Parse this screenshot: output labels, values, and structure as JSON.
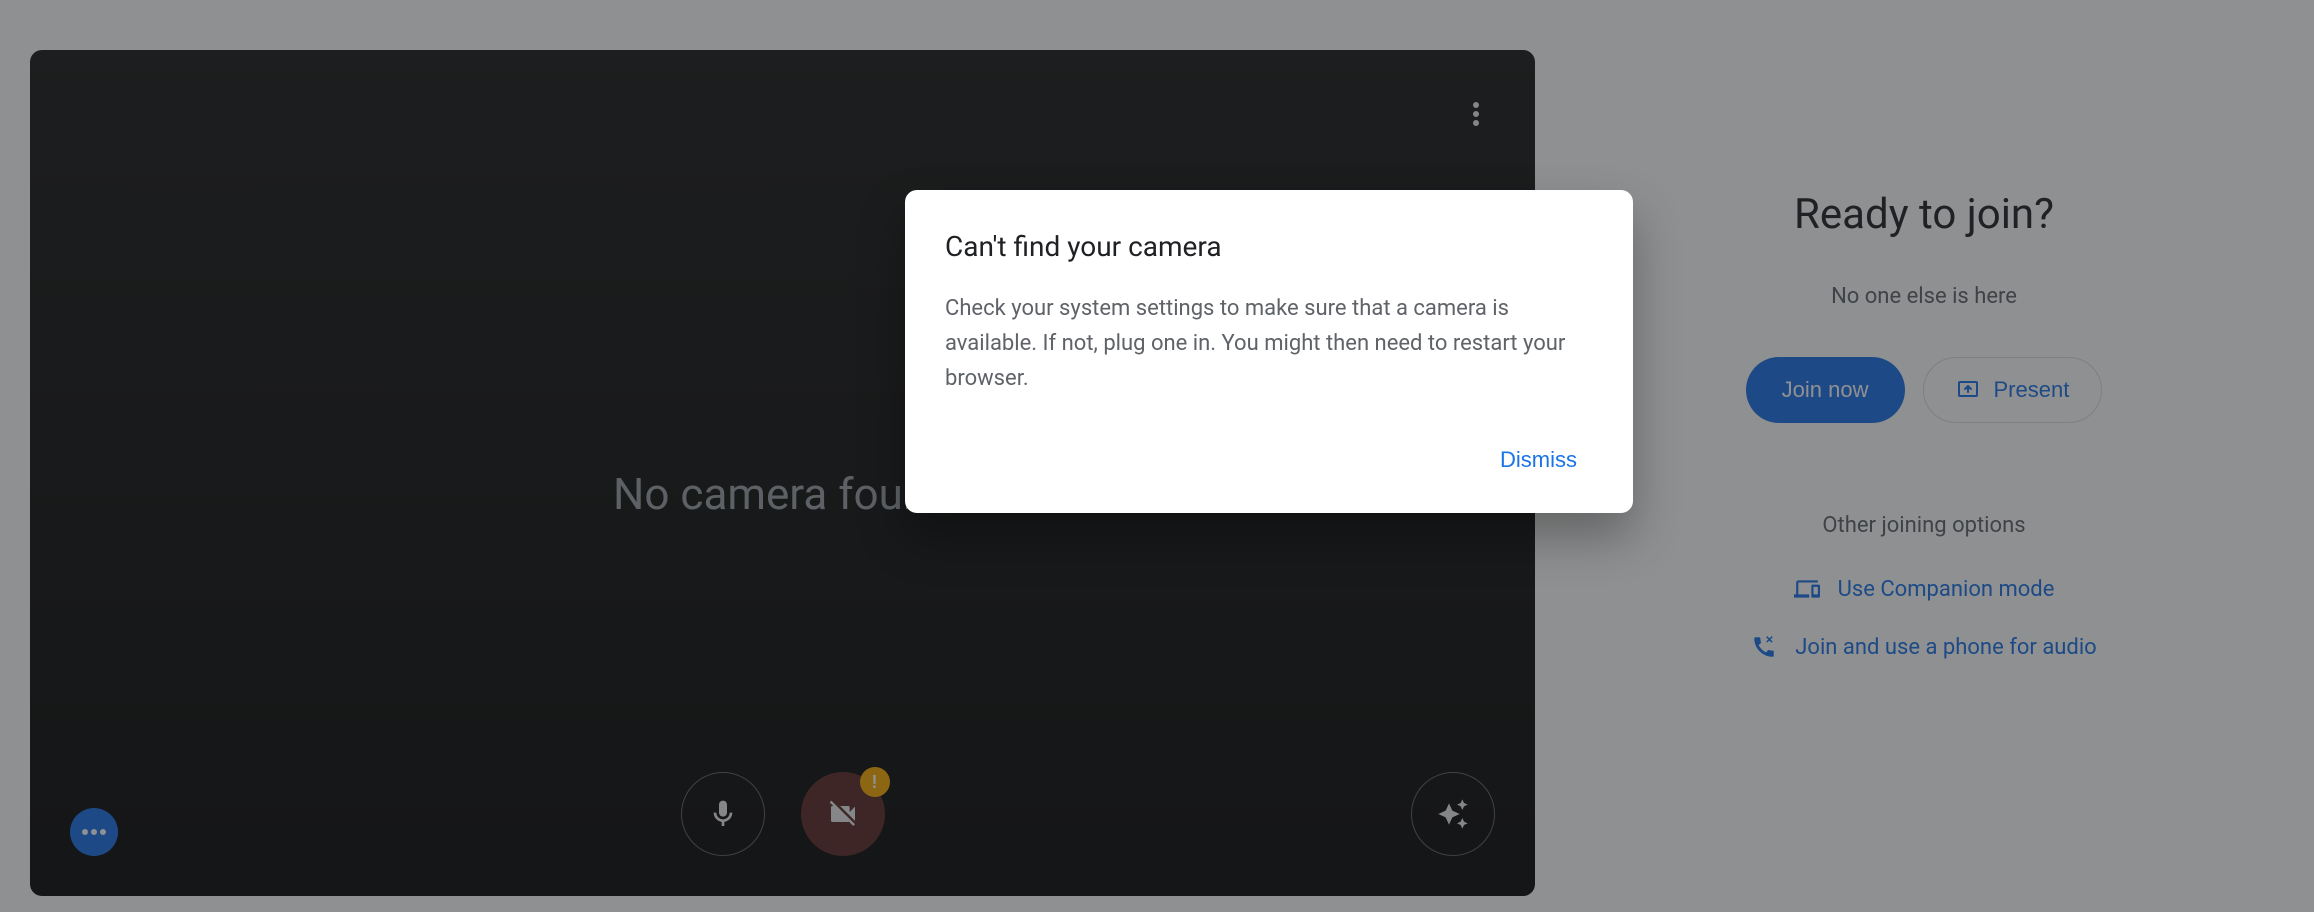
{
  "preview": {
    "no_camera_text": "No camera found"
  },
  "dialog": {
    "title": "Can't find your camera",
    "body": "Check your system settings to make sure that a camera is available. If not, plug one in. You might then need to restart your browser.",
    "dismiss_label": "Dismiss"
  },
  "right_panel": {
    "heading": "Ready to join?",
    "status": "No one else is here",
    "join_now_label": "Join now",
    "present_label": "Present",
    "other_options_heading": "Other joining options",
    "companion_label": "Use Companion mode",
    "phone_audio_label": "Join and use a phone for audio"
  }
}
